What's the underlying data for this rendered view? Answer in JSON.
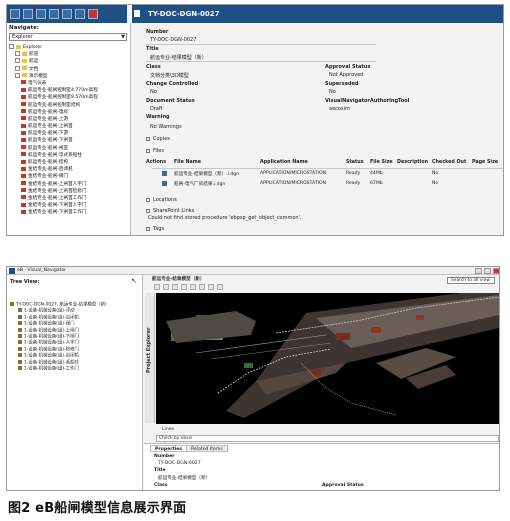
{
  "top": {
    "title": "TY-DOC-DGN-0027",
    "navigate_label": "Navigate:",
    "navigate_value": "Explorer",
    "tree": [
      {
        "label": "Explorer",
        "icon": "folder"
      },
      {
        "label": "航道",
        "icon": "folder"
      },
      {
        "label": "航运",
        "icon": "folder"
      },
      {
        "label": "文档",
        "icon": "folder"
      },
      {
        "label": "演示模型",
        "icon": "folder"
      },
      {
        "label": "电气仪表",
        "icon": "file"
      },
      {
        "label": "航运专业-船闸控制室4.770m高程",
        "icon": "file"
      },
      {
        "label": "航运专业-船闸控制室9.570m高程",
        "icon": "file"
      },
      {
        "label": "航运专业-船闸控制室结构",
        "icon": "file"
      },
      {
        "label": "航运专业-船闸-电房",
        "icon": "file"
      },
      {
        "label": "航运专业-船闸-上游",
        "icon": "file"
      },
      {
        "label": "航运专业-船闸-上闸首",
        "icon": "file"
      },
      {
        "label": "航运专业-船闸-下游",
        "icon": "file"
      },
      {
        "label": "航运专业-船闸-下闸首",
        "icon": "file"
      },
      {
        "label": "航运专业-船闸-闸室",
        "icon": "file"
      },
      {
        "label": "航运专业-船闸-浮式系船柱",
        "icon": "file"
      },
      {
        "label": "航运专业-船闸-结构",
        "icon": "file"
      },
      {
        "label": "金结专业-船闸-启闭机",
        "icon": "file"
      },
      {
        "label": "金结专业-船闸-阀门",
        "icon": "file"
      },
      {
        "label": "金结专业-船闸-上闸首人字门",
        "icon": "file"
      },
      {
        "label": "金结专业-船闸-上闸首检修门",
        "icon": "file"
      },
      {
        "label": "金结专业-船闸-上闸首工作门",
        "icon": "file"
      },
      {
        "label": "金结专业-船闸-下闸首人字门",
        "icon": "file"
      },
      {
        "label": "金结专业-船闸-下闸首工作门",
        "icon": "file"
      }
    ],
    "props": {
      "number_label": "Number",
      "number_value": "TY-DOC-DGN-0027",
      "title_label": "Title",
      "title_value": "航运专业-结果模型（新）",
      "class_label": "Class",
      "class_value": "文档分类\\3D模型",
      "approval_label": "Approval Status",
      "approval_value": "Not Approved",
      "change_label": "Change Controlled",
      "change_value": "No",
      "superseded_label": "Superseded",
      "superseded_value": "No",
      "docstatus_label": "Document Status",
      "docstatus_value": "Draft",
      "tool_label": "VisualNavigatorAuthoringTool",
      "tool_value": "aecosim",
      "warning_label": "Warning",
      "warning_value": "No Warnings"
    },
    "copies_label": "Copies",
    "files_label": "Files",
    "files_columns": [
      "Actions",
      "File Name",
      "Application Name",
      "Status",
      "File Size",
      "Description",
      "Checked Out",
      "Page Size"
    ],
    "files_rows": [
      {
        "name": "航运专业-结果模型（新）.i.dgn",
        "app": "APPLICATION/MICROSTATION",
        "status": "Ready",
        "size": "44Mb",
        "checked": "No"
      },
      {
        "name": "船闸-电气厂房结果.i.dgn",
        "app": "APPLICATION/MICROSTATION",
        "status": "Ready",
        "size": "67Mb",
        "checked": "No"
      }
    ],
    "locations_label": "Locations",
    "sharepoint_label": "SharePoint Links",
    "error_text": "Could not find stored procedure 'ebpsp_get_object_common'.",
    "tags_label": "Tags"
  },
  "bottom": {
    "window_title": "eB - Visual_Navigator",
    "tree_view_label": "Tree View:",
    "viewer_tab": "航运专业-结果模型（新）",
    "search_text": "Search to all view",
    "side_tab": "Project Explorer",
    "tree": [
      "TY-DOC-DGN-0027, 航运专业-结果模型（新）",
      "1-设备-机械设备(组)-浮动",
      "1-设备-机械设备(组)-启闭机",
      "1-设备-机械设备(组)-阀门",
      "1-设备-机械设备(组)-上闸门",
      "1-设备-机械设备(组)-下闸门",
      "1-设备-机械设备(组)-人字门",
      "1-设备-机械设备(组)-检修门",
      "1-设备-机械设备(组)-启闭机",
      "1-设备-机械设备(组)-系船柱",
      "1-设备-机械设备(组)-工作门"
    ],
    "footer_label": "Lines",
    "command_text": "Check by ebsei",
    "tab_properties": "Properties",
    "tab_related": "Related Items",
    "number_label": "Number",
    "number_value": "TY-DOC-DGN-0027",
    "title_label": "Title",
    "title_value": "航运专业-结果模型（新）",
    "class_label": "Class",
    "approval_label": "Approval Status"
  },
  "caption": "图2 eB船闸模型信息展示界面",
  "colors": {
    "header_blue": "#1f4f86",
    "scene_bg": "#000000"
  }
}
